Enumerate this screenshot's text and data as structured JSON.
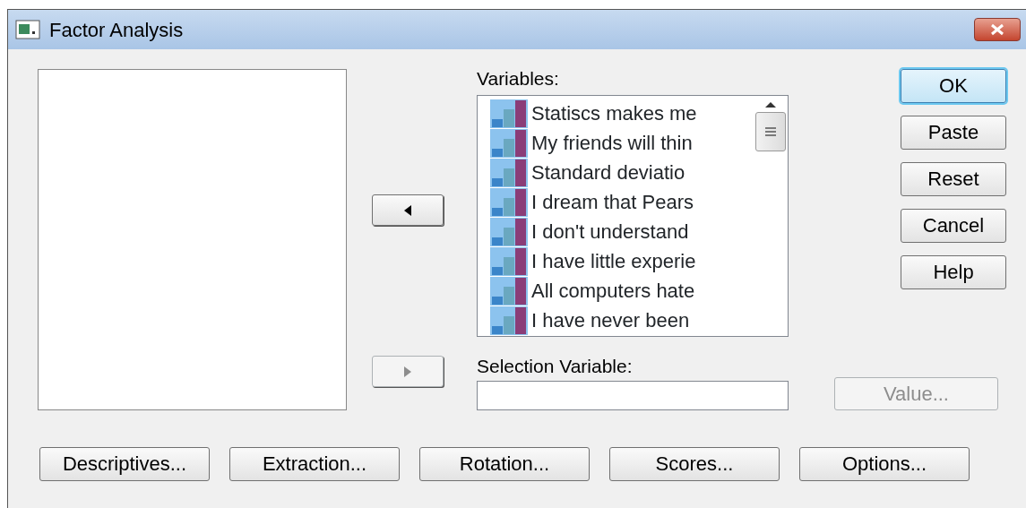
{
  "window": {
    "title": "Factor Analysis"
  },
  "transfer_buttons": [
    {
      "kind": "left",
      "disabled": false
    },
    {
      "kind": "right",
      "disabled": true
    }
  ],
  "variables": {
    "label": "Variables:",
    "items": [
      {
        "text": "Statiscs makes me"
      },
      {
        "text": "My friends will thin"
      },
      {
        "text": "Standard deviatio"
      },
      {
        "text": "I dream that Pears"
      },
      {
        "text": "I don't understand"
      },
      {
        "text": "I have little experie"
      },
      {
        "text": "All computers hate"
      },
      {
        "text": "I have never been"
      }
    ]
  },
  "selection_variable": {
    "label": "Selection Variable:",
    "value_button": {
      "label": "Value...",
      "disabled": true
    }
  },
  "action_buttons": [
    {
      "label": "OK",
      "default": true
    },
    {
      "label": "Paste",
      "default": false
    },
    {
      "label": "Reset",
      "default": false
    },
    {
      "label": "Cancel",
      "default": false
    },
    {
      "label": "Help",
      "default": false
    }
  ],
  "bottom_buttons": [
    {
      "label": "Descriptives..."
    },
    {
      "label": "Extraction..."
    },
    {
      "label": "Rotation..."
    },
    {
      "label": "Scores..."
    },
    {
      "label": "Options..."
    }
  ]
}
